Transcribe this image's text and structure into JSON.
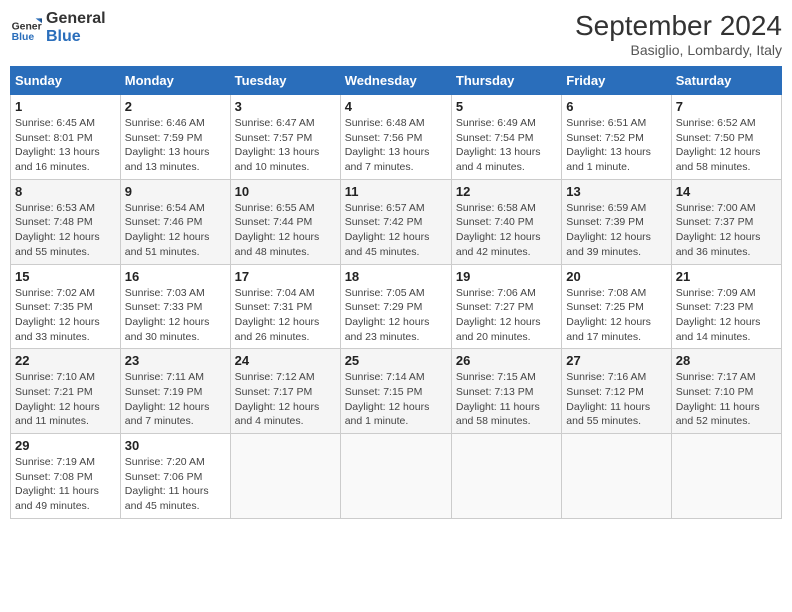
{
  "header": {
    "logo_line1": "General",
    "logo_line2": "Blue",
    "month": "September 2024",
    "location": "Basiglio, Lombardy, Italy"
  },
  "columns": [
    "Sunday",
    "Monday",
    "Tuesday",
    "Wednesday",
    "Thursday",
    "Friday",
    "Saturday"
  ],
  "weeks": [
    [
      {
        "day": "1",
        "detail": "Sunrise: 6:45 AM\nSunset: 8:01 PM\nDaylight: 13 hours and 16 minutes."
      },
      {
        "day": "2",
        "detail": "Sunrise: 6:46 AM\nSunset: 7:59 PM\nDaylight: 13 hours and 13 minutes."
      },
      {
        "day": "3",
        "detail": "Sunrise: 6:47 AM\nSunset: 7:57 PM\nDaylight: 13 hours and 10 minutes."
      },
      {
        "day": "4",
        "detail": "Sunrise: 6:48 AM\nSunset: 7:56 PM\nDaylight: 13 hours and 7 minutes."
      },
      {
        "day": "5",
        "detail": "Sunrise: 6:49 AM\nSunset: 7:54 PM\nDaylight: 13 hours and 4 minutes."
      },
      {
        "day": "6",
        "detail": "Sunrise: 6:51 AM\nSunset: 7:52 PM\nDaylight: 13 hours and 1 minute."
      },
      {
        "day": "7",
        "detail": "Sunrise: 6:52 AM\nSunset: 7:50 PM\nDaylight: 12 hours and 58 minutes."
      }
    ],
    [
      {
        "day": "8",
        "detail": "Sunrise: 6:53 AM\nSunset: 7:48 PM\nDaylight: 12 hours and 55 minutes."
      },
      {
        "day": "9",
        "detail": "Sunrise: 6:54 AM\nSunset: 7:46 PM\nDaylight: 12 hours and 51 minutes."
      },
      {
        "day": "10",
        "detail": "Sunrise: 6:55 AM\nSunset: 7:44 PM\nDaylight: 12 hours and 48 minutes."
      },
      {
        "day": "11",
        "detail": "Sunrise: 6:57 AM\nSunset: 7:42 PM\nDaylight: 12 hours and 45 minutes."
      },
      {
        "day": "12",
        "detail": "Sunrise: 6:58 AM\nSunset: 7:40 PM\nDaylight: 12 hours and 42 minutes."
      },
      {
        "day": "13",
        "detail": "Sunrise: 6:59 AM\nSunset: 7:39 PM\nDaylight: 12 hours and 39 minutes."
      },
      {
        "day": "14",
        "detail": "Sunrise: 7:00 AM\nSunset: 7:37 PM\nDaylight: 12 hours and 36 minutes."
      }
    ],
    [
      {
        "day": "15",
        "detail": "Sunrise: 7:02 AM\nSunset: 7:35 PM\nDaylight: 12 hours and 33 minutes."
      },
      {
        "day": "16",
        "detail": "Sunrise: 7:03 AM\nSunset: 7:33 PM\nDaylight: 12 hours and 30 minutes."
      },
      {
        "day": "17",
        "detail": "Sunrise: 7:04 AM\nSunset: 7:31 PM\nDaylight: 12 hours and 26 minutes."
      },
      {
        "day": "18",
        "detail": "Sunrise: 7:05 AM\nSunset: 7:29 PM\nDaylight: 12 hours and 23 minutes."
      },
      {
        "day": "19",
        "detail": "Sunrise: 7:06 AM\nSunset: 7:27 PM\nDaylight: 12 hours and 20 minutes."
      },
      {
        "day": "20",
        "detail": "Sunrise: 7:08 AM\nSunset: 7:25 PM\nDaylight: 12 hours and 17 minutes."
      },
      {
        "day": "21",
        "detail": "Sunrise: 7:09 AM\nSunset: 7:23 PM\nDaylight: 12 hours and 14 minutes."
      }
    ],
    [
      {
        "day": "22",
        "detail": "Sunrise: 7:10 AM\nSunset: 7:21 PM\nDaylight: 12 hours and 11 minutes."
      },
      {
        "day": "23",
        "detail": "Sunrise: 7:11 AM\nSunset: 7:19 PM\nDaylight: 12 hours and 7 minutes."
      },
      {
        "day": "24",
        "detail": "Sunrise: 7:12 AM\nSunset: 7:17 PM\nDaylight: 12 hours and 4 minutes."
      },
      {
        "day": "25",
        "detail": "Sunrise: 7:14 AM\nSunset: 7:15 PM\nDaylight: 12 hours and 1 minute."
      },
      {
        "day": "26",
        "detail": "Sunrise: 7:15 AM\nSunset: 7:13 PM\nDaylight: 11 hours and 58 minutes."
      },
      {
        "day": "27",
        "detail": "Sunrise: 7:16 AM\nSunset: 7:12 PM\nDaylight: 11 hours and 55 minutes."
      },
      {
        "day": "28",
        "detail": "Sunrise: 7:17 AM\nSunset: 7:10 PM\nDaylight: 11 hours and 52 minutes."
      }
    ],
    [
      {
        "day": "29",
        "detail": "Sunrise: 7:19 AM\nSunset: 7:08 PM\nDaylight: 11 hours and 49 minutes."
      },
      {
        "day": "30",
        "detail": "Sunrise: 7:20 AM\nSunset: 7:06 PM\nDaylight: 11 hours and 45 minutes."
      },
      null,
      null,
      null,
      null,
      null
    ]
  ]
}
